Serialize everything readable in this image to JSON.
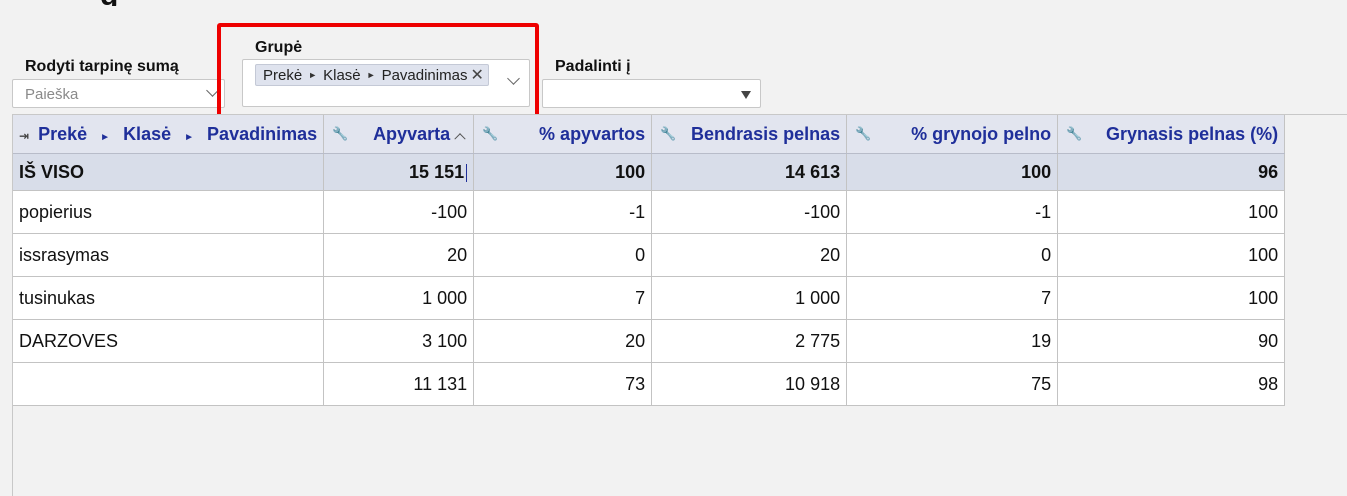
{
  "controls": {
    "subtotal": {
      "label": "Rodyti tarpinę sumą",
      "placeholder": "Paieška"
    },
    "group": {
      "label": "Grupė",
      "chip": {
        "parts": [
          "Prekė",
          "Klasė",
          "Pavadinimas"
        ],
        "remove_glyph": "✕"
      }
    },
    "split": {
      "label": "Padalinti į",
      "value": ""
    }
  },
  "table": {
    "group_header": {
      "parts": [
        "Prekė",
        "Klasė",
        "Pavadinimas"
      ]
    },
    "columns": [
      "Apyvarta",
      "% apyvartos",
      "Bendrasis pelnas",
      "% grynojo pelno",
      "Grynasis pelnas (%)"
    ],
    "total": {
      "label": "IŠ VISO",
      "values": [
        "15 151",
        "100",
        "14 613",
        "100",
        "96"
      ]
    },
    "rows": [
      {
        "label": "popierius",
        "values": [
          "-100",
          "-1",
          "-100",
          "-1",
          "100"
        ]
      },
      {
        "label": "issrasymas",
        "values": [
          "20",
          "0",
          "20",
          "0",
          "100"
        ]
      },
      {
        "label": "tusinukas",
        "values": [
          "1 000",
          "7",
          "1 000",
          "7",
          "100"
        ]
      },
      {
        "label": "DARZOVES",
        "values": [
          "3 100",
          "20",
          "2 775",
          "19",
          "90"
        ]
      },
      {
        "label": "",
        "values": [
          "11 131",
          "73",
          "10 918",
          "75",
          "98"
        ]
      }
    ]
  },
  "colors": {
    "header_text": "#1f2f9a",
    "highlight": "#ee0000",
    "total_bg": "#d8dde9"
  }
}
